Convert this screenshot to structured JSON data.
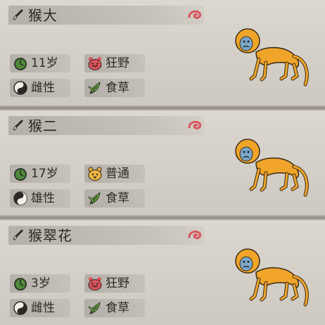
{
  "colors": {
    "fur": "#f0a52a",
    "fur_dark": "#c97d12",
    "face": "#7aa6c9",
    "swirl": "#d9545c",
    "age_icon": "#4f8a3a",
    "wild_icon": "#d9545c",
    "normal_icon": "#e9b443",
    "diet_icon": "#5f9a3c"
  },
  "monkeys": [
    {
      "name": "猴大",
      "age": "11岁",
      "temperament": "狂野",
      "temperament_icon": "wild-tiger-icon",
      "gender": "雌性",
      "diet": "食草",
      "name_icon": "brush-icon",
      "tag_icon": "swirl-icon"
    },
    {
      "name": "猴二",
      "age": "17岁",
      "temperament": "普通",
      "temperament_icon": "normal-bear-icon",
      "gender": "雄性",
      "diet": "食草",
      "name_icon": "brush-icon",
      "tag_icon": "swirl-icon"
    },
    {
      "name": "猴翠花",
      "age": "3岁",
      "temperament": "狂野",
      "temperament_icon": "wild-tiger-icon",
      "gender": "雌性",
      "diet": "食草",
      "name_icon": "brush-icon",
      "tag_icon": "swirl-icon"
    }
  ]
}
